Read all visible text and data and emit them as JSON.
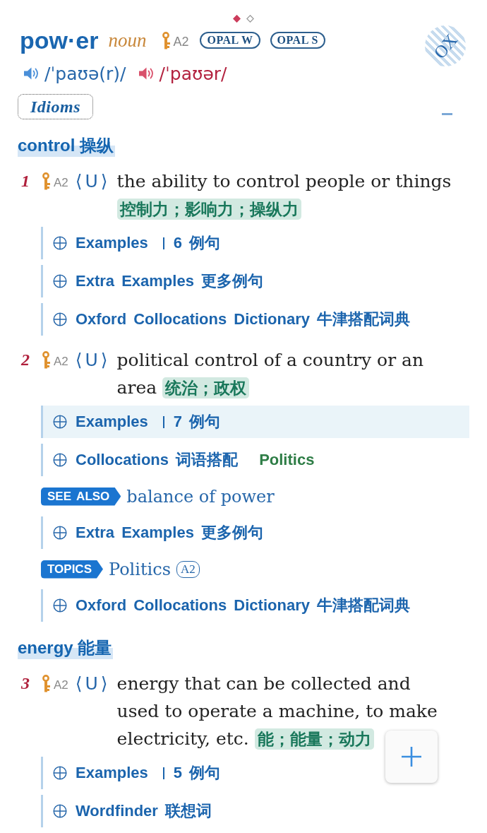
{
  "pager": [
    {
      "selected": true
    },
    {
      "selected": false
    }
  ],
  "entry": {
    "headword": "pow·er",
    "pos": "noun",
    "level": "A2",
    "badges": [
      "OPAL W",
      "OPAL S"
    ],
    "logo": "OX"
  },
  "pronunciations": [
    {
      "kind": "british",
      "text": "/ˈpaʊə(r)/"
    },
    {
      "kind": "american",
      "text": "/ˈpaʊər/"
    }
  ],
  "idioms_button": "Idioms",
  "sections": [
    {
      "heading": "control 操纵",
      "senses": [
        {
          "number": "1",
          "level": "A2",
          "grammar": "⟨U⟩",
          "definition": "the ability to control people or things",
          "translation": "控制力；影响力；操纵力",
          "items": [
            {
              "kind": "expander",
              "label": "Examples",
              "count": "6 例句",
              "highlighted": false
            },
            {
              "kind": "expander",
              "label": "Extra Examples 更多例句",
              "highlighted": false
            },
            {
              "kind": "expander",
              "label": "Oxford Collocations Dictionary 牛津搭配词典",
              "highlighted": false
            }
          ]
        },
        {
          "number": "2",
          "level": "A2",
          "grammar": "⟨U⟩",
          "definition": "political control of a country or an area",
          "translation": "统治；政权",
          "items": [
            {
              "kind": "expander",
              "label": "Examples",
              "count": "7 例句",
              "highlighted": true
            },
            {
              "kind": "expander",
              "label": "Collocations 词语搭配",
              "topic": "Politics",
              "highlighted": false
            },
            {
              "kind": "see_also",
              "tag": "SEE ALSO",
              "text": "balance of power"
            },
            {
              "kind": "expander",
              "label": "Extra Examples 更多例句",
              "highlighted": false
            },
            {
              "kind": "topic",
              "tag": "TOPICS",
              "text": "Politics",
              "level": "A2"
            },
            {
              "kind": "expander",
              "label": "Oxford Collocations Dictionary 牛津搭配词典",
              "highlighted": false
            }
          ]
        }
      ]
    },
    {
      "heading": "energy 能量",
      "senses": [
        {
          "number": "3",
          "level": "A2",
          "grammar": "⟨U⟩",
          "definition": "energy that can be collected and used to operate a machine, to make electricity, etc.",
          "translation": "能；能量；动力",
          "items": [
            {
              "kind": "expander",
              "label": "Examples",
              "count": "5 例句",
              "highlighted": false
            },
            {
              "kind": "expander",
              "label": "Wordfinder 联想词",
              "highlighted": false
            }
          ]
        }
      ]
    }
  ]
}
